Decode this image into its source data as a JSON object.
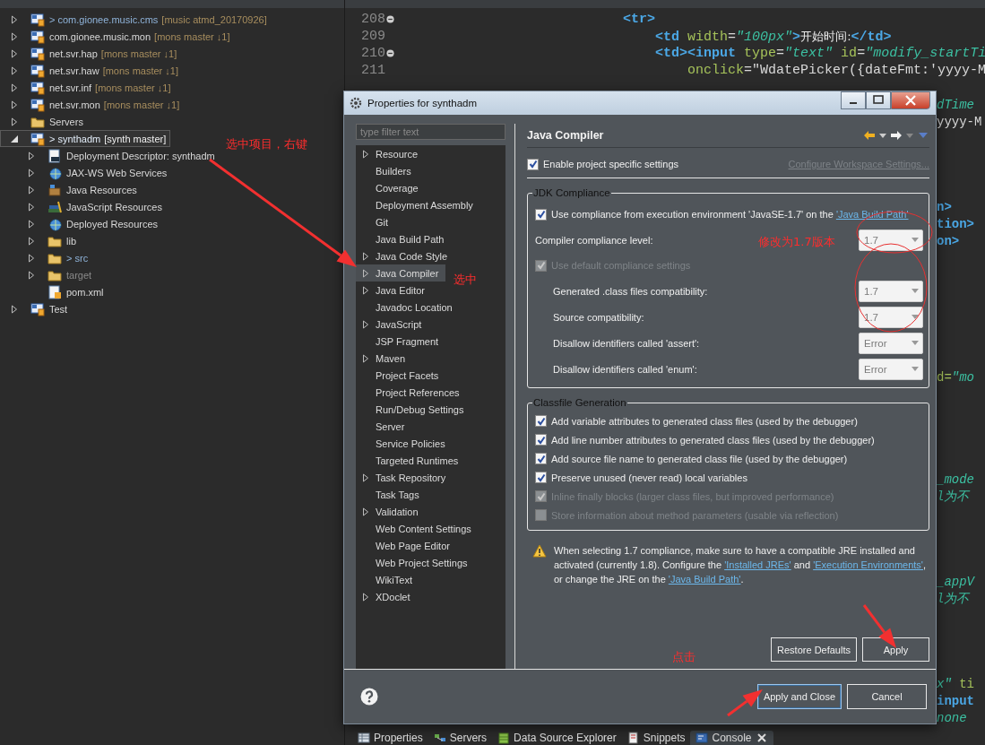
{
  "project_explorer": {
    "items": [
      {
        "label": "> com.gionee.music.cms",
        "decoration": "[music atmd_20170926]",
        "kind": "project",
        "expandable": true,
        "expanded": false,
        "dirty": true,
        "ignored": false,
        "selected": false
      },
      {
        "label": "com.gionee.music.mon",
        "decoration": "[mons master ↓1]",
        "kind": "project",
        "expandable": true,
        "expanded": false,
        "dirty": false,
        "ignored": false,
        "selected": false
      },
      {
        "label": "net.svr.hap",
        "decoration": "[mons master ↓1]",
        "kind": "project",
        "expandable": true,
        "expanded": false,
        "dirty": false,
        "ignored": false,
        "selected": false
      },
      {
        "label": "net.svr.haw",
        "decoration": "[mons master ↓1]",
        "kind": "project",
        "expandable": true,
        "expanded": false,
        "dirty": false,
        "ignored": false,
        "selected": false
      },
      {
        "label": "net.svr.inf",
        "decoration": "[mons master ↓1]",
        "kind": "project",
        "expandable": true,
        "expanded": false,
        "dirty": false,
        "ignored": false,
        "selected": false
      },
      {
        "label": "net.svr.mon",
        "decoration": "[mons master ↓1]",
        "kind": "project",
        "expandable": true,
        "expanded": false,
        "dirty": false,
        "ignored": false,
        "selected": false
      },
      {
        "label": "Servers",
        "kind": "folder",
        "expandable": true,
        "expanded": false,
        "dirty": false,
        "ignored": false,
        "selected": false
      },
      {
        "label": "> synthadm",
        "decoration": "[synth master]",
        "kind": "project",
        "expandable": true,
        "expanded": true,
        "dirty": true,
        "ignored": false,
        "selected": true,
        "children": [
          {
            "label": "Deployment Descriptor: synthadm",
            "kind": "descriptor",
            "expandable": true,
            "expanded": false,
            "dirty": false,
            "ignored": false,
            "selected": false
          },
          {
            "label": "JAX-WS Web Services",
            "kind": "globe",
            "expandable": true,
            "expanded": false,
            "dirty": false,
            "ignored": false,
            "selected": false
          },
          {
            "label": "Java Resources",
            "kind": "jar",
            "expandable": true,
            "expanded": false,
            "dirty": false,
            "ignored": false,
            "selected": false
          },
          {
            "label": "JavaScript Resources",
            "kind": "books",
            "expandable": true,
            "expanded": false,
            "dirty": false,
            "ignored": false,
            "selected": false
          },
          {
            "label": "Deployed Resources",
            "kind": "globe",
            "expandable": true,
            "expanded": false,
            "dirty": false,
            "ignored": false,
            "selected": false
          },
          {
            "label": "lib",
            "kind": "folder",
            "expandable": true,
            "expanded": false,
            "dirty": false,
            "ignored": false,
            "selected": false
          },
          {
            "label": "> src",
            "kind": "folder",
            "expandable": true,
            "expanded": false,
            "dirty": true,
            "ignored": false,
            "selected": false
          },
          {
            "label": "target",
            "kind": "folder",
            "expandable": true,
            "expanded": false,
            "dirty": false,
            "ignored": true,
            "selected": false
          },
          {
            "label": "pom.xml",
            "kind": "file",
            "expandable": false,
            "dirty": false,
            "ignored": false,
            "selected": false
          }
        ]
      },
      {
        "label": "Test",
        "kind": "project",
        "expandable": true,
        "expanded": false,
        "dirty": false,
        "ignored": false,
        "selected": false
      }
    ]
  },
  "editor": {
    "lines": [
      {
        "number": "208",
        "foldable": true,
        "tokens": [
          {
            "kind": "tag",
            "text": "<tr>"
          }
        ]
      },
      {
        "number": "209",
        "foldable": false,
        "tokens": [
          {
            "kind": "tag",
            "text": "<td"
          },
          {
            "kind": "attr",
            "text": " width"
          },
          {
            "kind": "plain",
            "text": "="
          },
          {
            "kind": "string",
            "text": "\"100px\""
          },
          {
            "kind": "tag",
            "text": ">"
          },
          {
            "kind": "text",
            "text": "开始时间:"
          },
          {
            "kind": "tag",
            "text": "</td>"
          }
        ]
      },
      {
        "number": "210",
        "foldable": true,
        "tokens": [
          {
            "kind": "tag",
            "text": "<td><input"
          },
          {
            "kind": "attr",
            "text": " type"
          },
          {
            "kind": "plain",
            "text": "="
          },
          {
            "kind": "string",
            "text": "\"text\""
          },
          {
            "kind": "attr",
            "text": " id"
          },
          {
            "kind": "plain",
            "text": "="
          },
          {
            "kind": "string",
            "text": "\"modify_startTi"
          }
        ]
      },
      {
        "number": "211",
        "foldable": false,
        "tokens": [
          {
            "kind": "attr",
            "text": "onclick"
          },
          {
            "kind": "plain",
            "text": "=\"WdatePicker({dateFmt:'yyyy-M"
          }
        ]
      }
    ],
    "fragments": [
      {
        "tokens": [
          {
            "kind": "string",
            "text": "dTime"
          }
        ]
      },
      {
        "tokens": [
          {
            "kind": "plain",
            "text": "yyyy-M"
          }
        ]
      },
      {
        "tokens": [
          {
            "kind": "tag",
            "text": "n>"
          }
        ]
      },
      {
        "tokens": [
          {
            "kind": "tag",
            "text": "tion>"
          }
        ]
      },
      {
        "tokens": [
          {
            "kind": "tag",
            "text": "on>"
          }
        ]
      },
      {
        "tokens": [
          {
            "kind": "attr",
            "text": "d="
          },
          {
            "kind": "string",
            "text": "\"mo"
          }
        ]
      },
      {
        "tokens": [
          {
            "kind": "string",
            "text": "_mode"
          }
        ]
      },
      {
        "tokens": [
          {
            "kind": "string",
            "text": "l为不"
          }
        ]
      },
      {
        "tokens": [
          {
            "kind": "string",
            "text": "_appV"
          }
        ]
      },
      {
        "tokens": [
          {
            "kind": "string",
            "text": "l为不"
          }
        ]
      },
      {
        "tokens": [
          {
            "kind": "string",
            "text": "x\""
          },
          {
            "kind": "attr",
            "text": " ti"
          }
        ]
      },
      {
        "tokens": [
          {
            "kind": "tag",
            "text": "input"
          }
        ]
      },
      {
        "tokens": [
          {
            "kind": "string",
            "text": "none"
          }
        ]
      }
    ]
  },
  "dialog": {
    "title": "Properties for synthadm",
    "filter": {
      "placeholder": "type filter text"
    },
    "pages": [
      {
        "label": "Resource",
        "expandable": true,
        "selected": false
      },
      {
        "label": "Builders",
        "expandable": false,
        "selected": false
      },
      {
        "label": "Coverage",
        "expandable": false,
        "selected": false
      },
      {
        "label": "Deployment Assembly",
        "expandable": false,
        "selected": false
      },
      {
        "label": "Git",
        "expandable": false,
        "selected": false
      },
      {
        "label": "Java Build Path",
        "expandable": false,
        "selected": false
      },
      {
        "label": "Java Code Style",
        "expandable": true,
        "selected": false
      },
      {
        "label": "Java Compiler",
        "expandable": true,
        "selected": true
      },
      {
        "label": "Java Editor",
        "expandable": true,
        "selected": false
      },
      {
        "label": "Javadoc Location",
        "expandable": false,
        "selected": false
      },
      {
        "label": "JavaScript",
        "expandable": true,
        "selected": false
      },
      {
        "label": "JSP Fragment",
        "expandable": false,
        "selected": false
      },
      {
        "label": "Maven",
        "expandable": true,
        "selected": false
      },
      {
        "label": "Project Facets",
        "expandable": false,
        "selected": false
      },
      {
        "label": "Project References",
        "expandable": false,
        "selected": false
      },
      {
        "label": "Run/Debug Settings",
        "expandable": false,
        "selected": false
      },
      {
        "label": "Server",
        "expandable": false,
        "selected": false
      },
      {
        "label": "Service Policies",
        "expandable": false,
        "selected": false
      },
      {
        "label": "Targeted Runtimes",
        "expandable": false,
        "selected": false
      },
      {
        "label": "Task Repository",
        "expandable": true,
        "selected": false
      },
      {
        "label": "Task Tags",
        "expandable": false,
        "selected": false
      },
      {
        "label": "Validation",
        "expandable": true,
        "selected": false
      },
      {
        "label": "Web Content Settings",
        "expandable": false,
        "selected": false
      },
      {
        "label": "Web Page Editor",
        "expandable": false,
        "selected": false
      },
      {
        "label": "Web Project Settings",
        "expandable": false,
        "selected": false
      },
      {
        "label": "WikiText",
        "expandable": false,
        "selected": false
      },
      {
        "label": "XDoclet",
        "expandable": true,
        "selected": false
      }
    ],
    "page_title": "Java Compiler",
    "enable_specific": {
      "label": "Enable project specific settings",
      "checked": true
    },
    "configure_link": {
      "text": "Configure Workspace Settings...",
      "disabled": true
    },
    "jdk_group": {
      "title": "JDK Compliance",
      "rows": [
        {
          "kind": "checkbox",
          "label": "Use compliance from execution environment 'JavaSE-1.7' on the ",
          "link": "'Java Build Path'",
          "checked": true,
          "disabled": false
        },
        {
          "kind": "combo",
          "label": "Compiler compliance level:",
          "value": "1.7"
        },
        {
          "kind": "checkbox",
          "label": "Use default compliance settings",
          "checked": true,
          "disabled": true,
          "children": [
            {
              "kind": "combo",
              "label": "Generated .class files compatibility:",
              "value": "1.7"
            },
            {
              "kind": "combo",
              "label": "Source compatibility:",
              "value": "1.7"
            },
            {
              "kind": "combo",
              "label": "Disallow identifiers called 'assert':",
              "value": "Error"
            },
            {
              "kind": "combo",
              "label": "Disallow identifiers called 'enum':",
              "value": "Error"
            }
          ]
        }
      ]
    },
    "classfile_group": {
      "title": "Classfile Generation",
      "options": [
        {
          "label": "Add variable attributes to generated class files (used by the debugger)",
          "checked": true,
          "disabled": false
        },
        {
          "label": "Add line number attributes to generated class files (used by the debugger)",
          "checked": true,
          "disabled": false
        },
        {
          "label": "Add source file name to generated class file (used by the debugger)",
          "checked": true,
          "disabled": false
        },
        {
          "label": "Preserve unused (never read) local variables",
          "checked": true,
          "disabled": false
        },
        {
          "label": "Inline finally blocks (larger class files, but improved performance)",
          "checked": true,
          "disabled": true
        },
        {
          "label": "Store information about method parameters (usable via reflection)",
          "checked": false,
          "disabled": true
        }
      ]
    },
    "warning": {
      "parts": [
        {
          "kind": "text",
          "text": "When selecting 1.7 compliance, make sure to have a compatible JRE installed and activated (currently 1.8). Configure the "
        },
        {
          "kind": "link",
          "text": "'Installed JREs'"
        },
        {
          "kind": "text",
          "text": " and "
        },
        {
          "kind": "link",
          "text": "'Execution Environments'"
        },
        {
          "kind": "text",
          "text": ", or change the JRE on the "
        },
        {
          "kind": "link",
          "text": "'Java Build Path'"
        },
        {
          "kind": "text",
          "text": "."
        }
      ]
    },
    "page_buttons": [
      {
        "label": "Restore Defaults"
      },
      {
        "label": "Apply"
      }
    ],
    "footer_buttons": [
      {
        "label": "Apply and Close",
        "default": true
      },
      {
        "label": "Cancel",
        "default": false
      }
    ]
  },
  "bottom_tabs": [
    {
      "label": "Properties",
      "kind": "table",
      "selected": false
    },
    {
      "label": "Servers",
      "kind": "servers",
      "selected": false
    },
    {
      "label": "Data Source Explorer",
      "kind": "database",
      "selected": false
    },
    {
      "label": "Snippets",
      "kind": "snippets",
      "selected": false
    },
    {
      "label": "Console",
      "kind": "console",
      "selected": true
    }
  ],
  "annotations": [
    {
      "text": "选中项目，右键"
    },
    {
      "text": "选中"
    },
    {
      "text": "修改为1.7版本"
    },
    {
      "text": "点击"
    }
  ]
}
